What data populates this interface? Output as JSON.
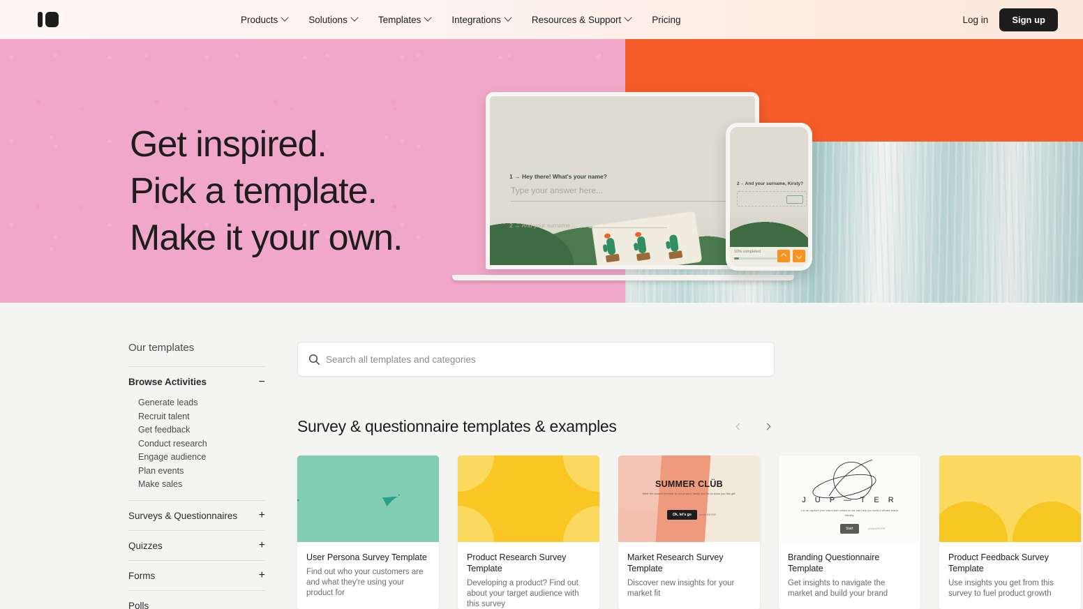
{
  "navbar": {
    "logo_name": "typeform-logo",
    "menu": [
      {
        "label": "Products",
        "has_chevron": true
      },
      {
        "label": "Solutions",
        "has_chevron": true
      },
      {
        "label": "Templates",
        "has_chevron": true
      },
      {
        "label": "Integrations",
        "has_chevron": true
      },
      {
        "label": "Resources & Support",
        "has_chevron": true
      },
      {
        "label": "Pricing",
        "has_chevron": false
      }
    ],
    "login_label": "Log in",
    "signup_label": "Sign up",
    "signup_bg": "#1d1d1d"
  },
  "hero": {
    "line1": "Get inspired.",
    "line2": "Pick a template.",
    "line3": "Make it your own.",
    "bg_pink": "#f1a8c8",
    "bg_orange": "#f75c2b",
    "bg_teal": "#bfd8d6",
    "laptop": {
      "question": "1 → Hey there! What's your name?",
      "answer_placeholder": "Type your answer here...",
      "question2": "2 → And your surname..."
    },
    "phone": {
      "question": "2→ And your surname, Kirsty?",
      "progress_label": "10% completed",
      "progress_percent": 10
    }
  },
  "sidebar": {
    "title": "Our templates",
    "groups": [
      {
        "label": "Browse Activities",
        "toggle": "−",
        "expanded": true,
        "items": [
          "Generate leads",
          "Recruit talent",
          "Get feedback",
          "Conduct research",
          "Engage audience",
          "Plan events",
          "Make sales"
        ]
      },
      {
        "label": "Surveys & Questionnaires",
        "toggle": "+",
        "expanded": false,
        "items": []
      },
      {
        "label": "Quizzes",
        "toggle": "+",
        "expanded": false,
        "items": []
      },
      {
        "label": "Forms",
        "toggle": "+",
        "expanded": false,
        "items": []
      }
    ],
    "last_item": "Polls"
  },
  "search": {
    "placeholder": "Search all templates and categories",
    "value": "",
    "icon": "search-icon"
  },
  "section": {
    "title": "Survey & questionnaire templates & examples",
    "prev_label": "‹",
    "next_label": "›"
  },
  "cards": [
    {
      "title": "User Persona Survey Template",
      "desc": "Find out who your customers are and what they're using your product for",
      "art": "heads",
      "bg": "#28a08a"
    },
    {
      "title": "Product Research Survey Template",
      "desc": "Developing a product? Find out about your target audience with this survey",
      "art": "star",
      "bg": "#f9c624"
    },
    {
      "title": "Market Research Survey Template",
      "desc": "Discover new insights for your market fit",
      "art": "market",
      "bg": "#f2e9da",
      "art_title": "SUMMER CLÜB",
      "art_sub": "Meet the newest member of our product family and let us show you this gift.",
      "art_btn": "Ok, let's go",
      "art_tag": "press ENTER"
    },
    {
      "title": "Branding Questionnaire Template",
      "desc": "Get insights to navigate the market and build your brand",
      "art": "brand",
      "bg": "#fbfbfa",
      "art_title": "J U P — T E R",
      "art_sub": "Let us capture your vision and values so we can help you build a vibrant brand identity.",
      "art_btn": "Start",
      "art_tag": "press ENTER"
    },
    {
      "title": "Product Feedback Survey Template",
      "desc": "Use insights you get from this survey to fuel product growth",
      "art": "heart",
      "bg": "#fbd85e"
    }
  ]
}
